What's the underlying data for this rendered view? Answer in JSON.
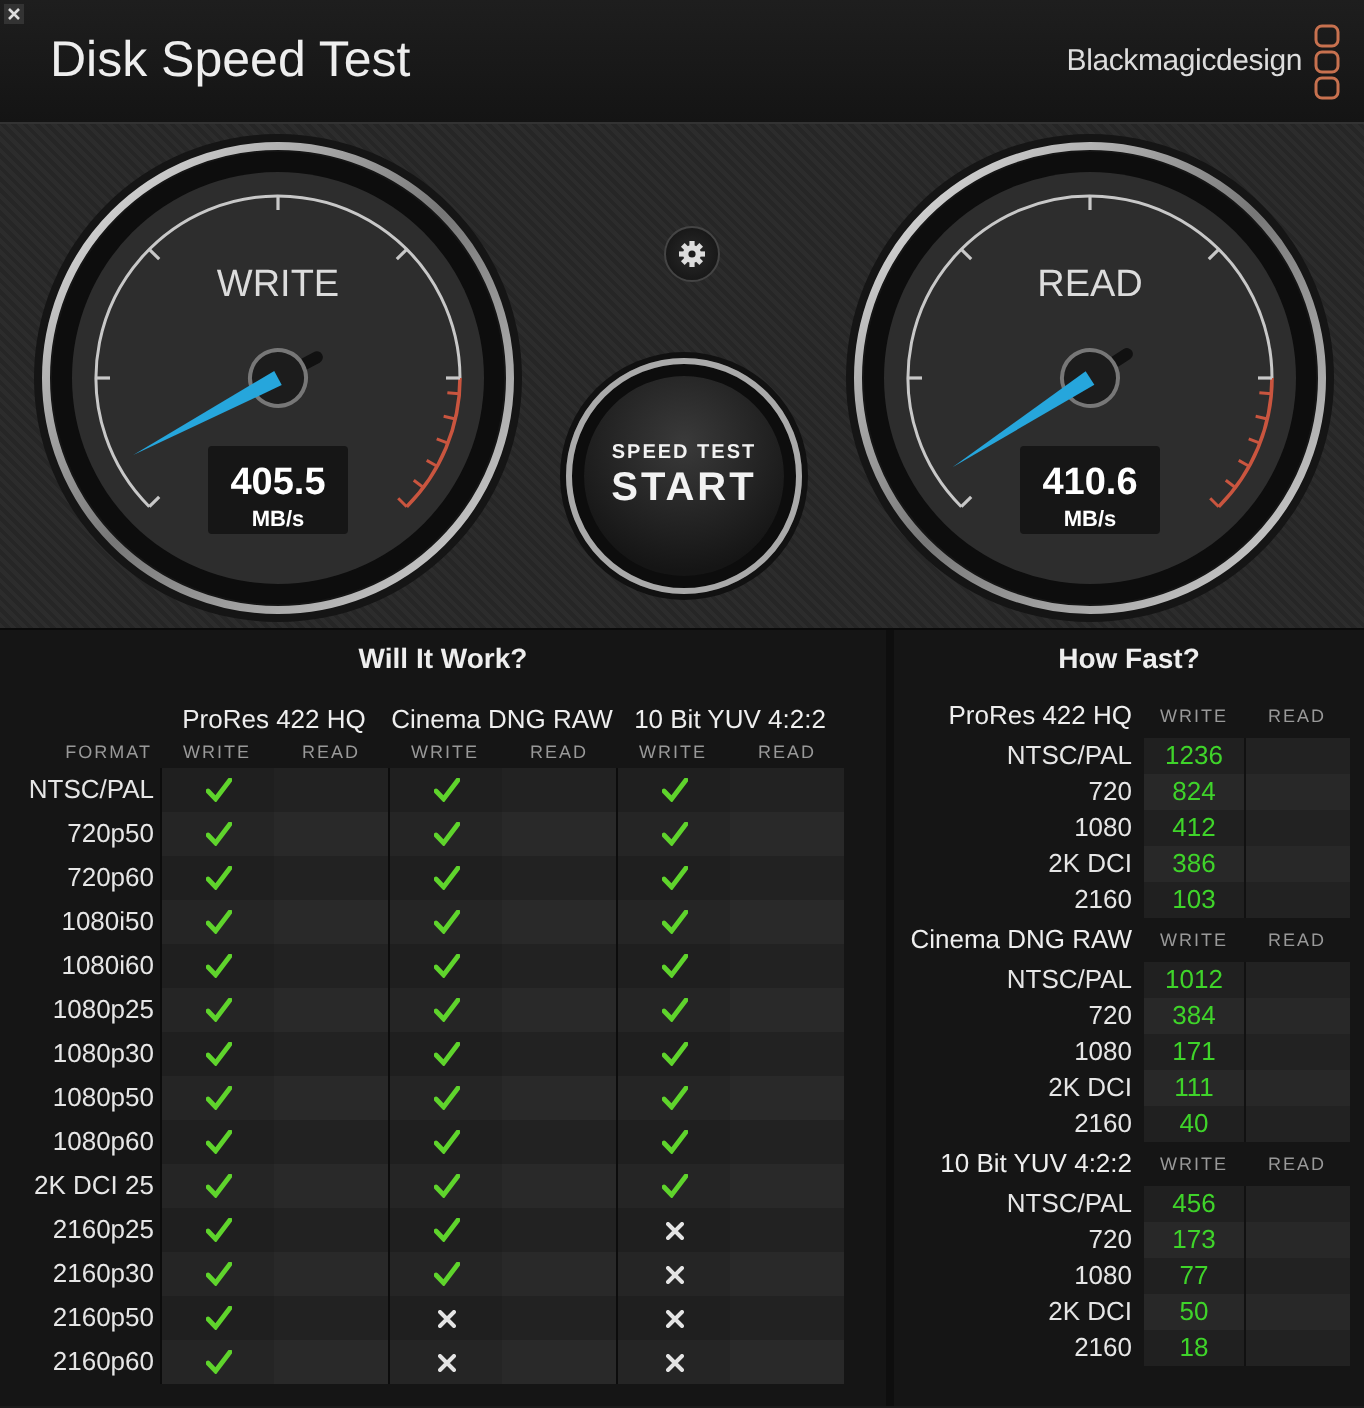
{
  "window": {
    "title": "Disk Speed Test",
    "brand": "Blackmagicdesign"
  },
  "gauges": [
    {
      "label": "WRITE",
      "value": "405.5",
      "unit": "MB/s"
    },
    {
      "label": "READ",
      "value": "410.6",
      "unit": "MB/s"
    }
  ],
  "start_button": {
    "caption": "SPEED TEST",
    "label": "START"
  },
  "will_it_work": {
    "title": "Will It Work?",
    "format_header": "FORMAT",
    "codecs": [
      {
        "name": "ProRes 422 HQ",
        "write_header": "WRITE",
        "read_header": "READ"
      },
      {
        "name": "Cinema DNG RAW",
        "write_header": "WRITE",
        "read_header": "READ"
      },
      {
        "name": "10 Bit YUV 4:2:2",
        "write_header": "WRITE",
        "read_header": "READ"
      }
    ],
    "rows": [
      {
        "format": "NTSC/PAL",
        "passes": [
          true,
          true,
          true
        ]
      },
      {
        "format": "720p50",
        "passes": [
          true,
          true,
          true
        ]
      },
      {
        "format": "720p60",
        "passes": [
          true,
          true,
          true
        ]
      },
      {
        "format": "1080i50",
        "passes": [
          true,
          true,
          true
        ]
      },
      {
        "format": "1080i60",
        "passes": [
          true,
          true,
          true
        ]
      },
      {
        "format": "1080p25",
        "passes": [
          true,
          true,
          true
        ]
      },
      {
        "format": "1080p30",
        "passes": [
          true,
          true,
          true
        ]
      },
      {
        "format": "1080p50",
        "passes": [
          true,
          true,
          true
        ]
      },
      {
        "format": "1080p60",
        "passes": [
          true,
          true,
          true
        ]
      },
      {
        "format": "2K DCI 25",
        "passes": [
          true,
          true,
          true
        ]
      },
      {
        "format": "2160p25",
        "passes": [
          true,
          true,
          false
        ]
      },
      {
        "format": "2160p30",
        "passes": [
          true,
          true,
          false
        ]
      },
      {
        "format": "2160p50",
        "passes": [
          true,
          false,
          false
        ]
      },
      {
        "format": "2160p60",
        "passes": [
          true,
          false,
          false
        ]
      }
    ]
  },
  "how_fast": {
    "title": "How Fast?",
    "groups": [
      {
        "codec": "ProRes 422 HQ",
        "write_header": "WRITE",
        "read_header": "READ",
        "rows": [
          {
            "format": "NTSC/PAL",
            "write": "1236"
          },
          {
            "format": "720",
            "write": "824"
          },
          {
            "format": "1080",
            "write": "412"
          },
          {
            "format": "2K DCI",
            "write": "386"
          },
          {
            "format": "2160",
            "write": "103"
          }
        ]
      },
      {
        "codec": "Cinema DNG RAW",
        "write_header": "WRITE",
        "read_header": "READ",
        "rows": [
          {
            "format": "NTSC/PAL",
            "write": "1012"
          },
          {
            "format": "720",
            "write": "384"
          },
          {
            "format": "1080",
            "write": "171"
          },
          {
            "format": "2K DCI",
            "write": "111"
          },
          {
            "format": "2160",
            "write": "40"
          }
        ]
      },
      {
        "codec": "10 Bit YUV 4:2:2",
        "write_header": "WRITE",
        "read_header": "READ",
        "rows": [
          {
            "format": "NTSC/PAL",
            "write": "456"
          },
          {
            "format": "720",
            "write": "173"
          },
          {
            "format": "1080",
            "write": "77"
          },
          {
            "format": "2K DCI",
            "write": "50"
          },
          {
            "format": "2160",
            "write": "18"
          }
        ]
      }
    ]
  }
}
